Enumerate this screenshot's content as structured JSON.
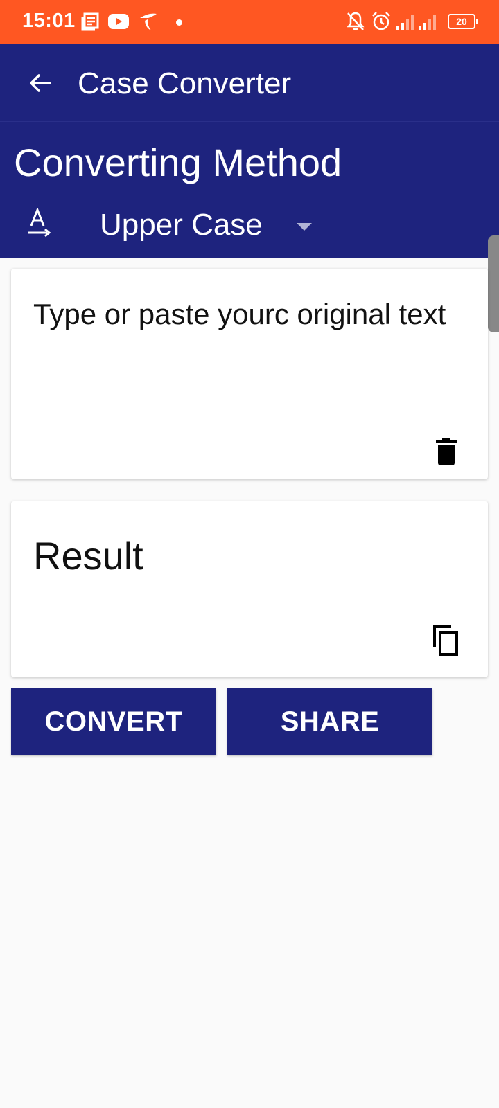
{
  "status_bar": {
    "time": "15:01",
    "battery": "20",
    "color": "#ff5722"
  },
  "app_bar": {
    "title": "Case Converter",
    "color": "#1e237e"
  },
  "method": {
    "heading": "Converting Method",
    "selected": "Upper Case"
  },
  "input": {
    "placeholder": "Type or paste yourc original text"
  },
  "result": {
    "label": "Result"
  },
  "actions": {
    "convert_label": "CONVERT",
    "share_label": "SHARE"
  },
  "icons": [
    "news-icon",
    "youtube-icon",
    "telenor-icon",
    "notifications-off-icon",
    "alarm-icon",
    "signal-icon",
    "battery-icon",
    "back-arrow-icon",
    "text-format-icon",
    "dropdown-arrow-icon",
    "delete-icon",
    "copy-icon"
  ]
}
